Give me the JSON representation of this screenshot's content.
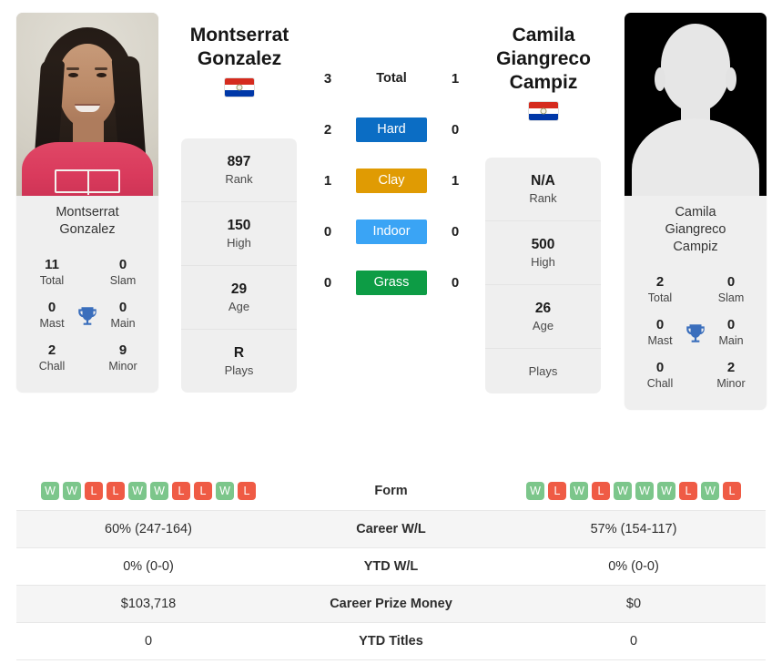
{
  "players": {
    "left": {
      "name_line1": "Montserrat",
      "name_line2": "Gonzalez",
      "full_name": "Montserrat Gonzalez",
      "caption_line1": "Montserrat",
      "caption_line2": "Gonzalez",
      "country_flag": "paraguay-flag",
      "avatar_type": "photo",
      "info": [
        {
          "value": "897",
          "label": "Rank"
        },
        {
          "value": "150",
          "label": "High"
        },
        {
          "value": "29",
          "label": "Age"
        },
        {
          "value": "R",
          "label": "Plays"
        }
      ],
      "titles": [
        {
          "value": "11",
          "label": "Total"
        },
        {
          "value": "0",
          "label": "Slam"
        },
        {
          "value": "0",
          "label": "Mast"
        },
        {
          "value": "0",
          "label": "Main"
        },
        {
          "value": "2",
          "label": "Chall"
        },
        {
          "value": "9",
          "label": "Minor"
        }
      ],
      "form": [
        "W",
        "W",
        "L",
        "L",
        "W",
        "W",
        "L",
        "L",
        "W",
        "L"
      ],
      "career_wl": "60% (247-164)",
      "ytd_wl": "0% (0-0)",
      "career_prize_money": "$103,718",
      "ytd_titles": "0"
    },
    "right": {
      "name_line1": "Camila",
      "name_line2": "Giangreco",
      "name_line3": "Campiz",
      "full_name": "Camila Giangreco Campiz",
      "caption_line1": "Camila",
      "caption_line2": "Giangreco",
      "caption_line3": "Campiz",
      "country_flag": "paraguay-flag",
      "avatar_type": "silhouette-placeholder",
      "info": [
        {
          "value": "N/A",
          "label": "Rank"
        },
        {
          "value": "500",
          "label": "High"
        },
        {
          "value": "26",
          "label": "Age"
        },
        {
          "value": "",
          "label": "Plays"
        }
      ],
      "titles": [
        {
          "value": "2",
          "label": "Total"
        },
        {
          "value": "0",
          "label": "Slam"
        },
        {
          "value": "0",
          "label": "Mast"
        },
        {
          "value": "0",
          "label": "Main"
        },
        {
          "value": "0",
          "label": "Chall"
        },
        {
          "value": "2",
          "label": "Minor"
        }
      ],
      "form": [
        "W",
        "L",
        "W",
        "L",
        "W",
        "W",
        "W",
        "L",
        "W",
        "L"
      ],
      "career_wl": "57% (154-117)",
      "ytd_wl": "0% (0-0)",
      "career_prize_money": "$0",
      "ytd_titles": "0"
    }
  },
  "head_to_head": {
    "rows": [
      {
        "left": "3",
        "surface": "Total",
        "right": "1",
        "color": "none",
        "style": "plain"
      },
      {
        "left": "2",
        "surface": "Hard",
        "right": "0",
        "color": "#0b6dc4",
        "style": "badge"
      },
      {
        "left": "1",
        "surface": "Clay",
        "right": "1",
        "color": "#e09b03",
        "style": "badge"
      },
      {
        "left": "0",
        "surface": "Indoor",
        "right": "0",
        "color": "#3aa4f5",
        "style": "badge"
      },
      {
        "left": "0",
        "surface": "Grass",
        "right": "0",
        "color": "#0d9c45",
        "style": "badge"
      }
    ]
  },
  "comparison_table": {
    "rows": [
      {
        "label": "Form",
        "kind": "form"
      },
      {
        "label": "Career W/L",
        "kind": "text"
      },
      {
        "label": "YTD W/L",
        "kind": "text"
      },
      {
        "label": "Career Prize Money",
        "kind": "text"
      },
      {
        "label": "YTD Titles",
        "kind": "text"
      }
    ]
  },
  "colors": {
    "win_badge": "#7cc68b",
    "loss_badge": "#ef5b45",
    "card_bg": "#efefef",
    "row_shade": "#f5f5f5",
    "trophy": "#3a6ebc"
  }
}
